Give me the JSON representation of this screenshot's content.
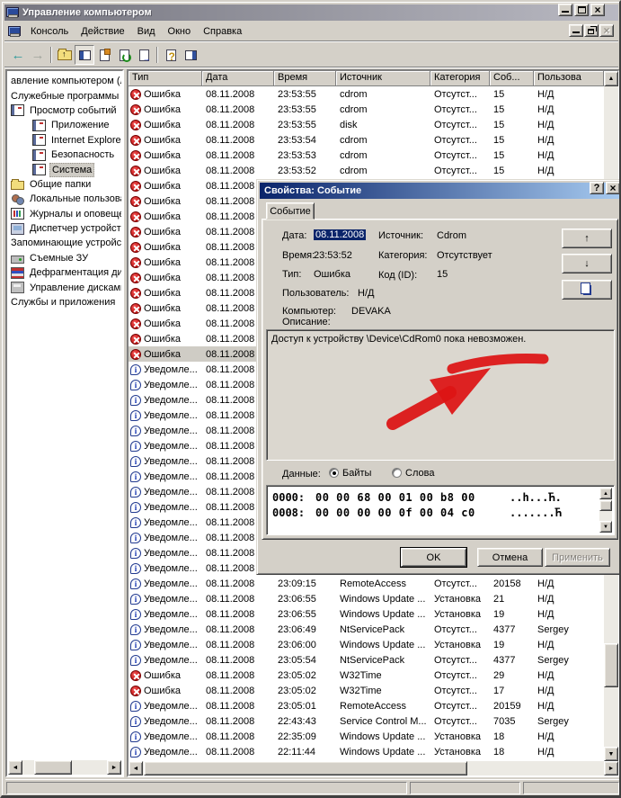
{
  "window": {
    "title": "Управление компьютером",
    "controls": {
      "minimize": "minimize",
      "maximize": "maximize",
      "close": "close"
    }
  },
  "menu": {
    "items": [
      "Консоль",
      "Действие",
      "Вид",
      "Окно",
      "Справка"
    ]
  },
  "toolbar": {
    "buttons": [
      {
        "icon": "back-icon",
        "glyph": "←"
      },
      {
        "icon": "forward-icon",
        "glyph": "→"
      },
      {
        "icon": "separator"
      },
      {
        "icon": "up-folder-icon"
      },
      {
        "icon": "toggle-tree-icon",
        "pressed": true
      },
      {
        "icon": "properties-icon"
      },
      {
        "icon": "refresh-icon"
      },
      {
        "icon": "export-list-icon"
      },
      {
        "icon": "separator"
      },
      {
        "icon": "help-icon"
      },
      {
        "icon": "show-panel-icon"
      }
    ]
  },
  "sidebar": {
    "items": [
      {
        "label": "авление компьютером (л",
        "level": 0,
        "icon": ""
      },
      {
        "label": "Служебные программы",
        "level": 0,
        "icon": ""
      },
      {
        "label": "Просмотр событий",
        "level": 1,
        "icon": "event-log"
      },
      {
        "label": "Приложение",
        "level": 2,
        "icon": "log-book"
      },
      {
        "label": "Internet Explorer",
        "level": 2,
        "icon": "log-book"
      },
      {
        "label": "Безопасность",
        "level": 2,
        "icon": "log-book"
      },
      {
        "label": "Система",
        "level": 2,
        "icon": "log-book",
        "selected": true
      },
      {
        "label": "Общие папки",
        "level": 1,
        "icon": "folder"
      },
      {
        "label": "Локальные пользова",
        "level": 1,
        "icon": "users"
      },
      {
        "label": "Журналы и оповещен",
        "level": 1,
        "icon": "perf"
      },
      {
        "label": "Диспетчер устройсте",
        "level": 1,
        "icon": "devmgr"
      },
      {
        "label": "Запоминающие устройст",
        "level": 0,
        "icon": ""
      },
      {
        "label": "Съемные ЗУ",
        "level": 1,
        "icon": "removable"
      },
      {
        "label": "Дефрагментация дис",
        "level": 1,
        "icon": "defrag"
      },
      {
        "label": "Управление дисками",
        "level": 1,
        "icon": "diskmgmt"
      },
      {
        "label": "Службы и приложения",
        "level": 0,
        "icon": ""
      }
    ]
  },
  "table": {
    "columns": [
      "Тип",
      "Дата",
      "Время",
      "Источник",
      "Категория",
      "Соб...",
      "Пользова"
    ],
    "type_labels": {
      "error": "Ошибка",
      "info": "Уведомле..."
    },
    "rows": [
      {
        "type": "error",
        "date": "08.11.2008",
        "time": "23:53:55",
        "source": "cdrom",
        "category": "Отсутст...",
        "event": "15",
        "user": "Н/Д"
      },
      {
        "type": "error",
        "date": "08.11.2008",
        "time": "23:53:55",
        "source": "cdrom",
        "category": "Отсутст...",
        "event": "15",
        "user": "Н/Д"
      },
      {
        "type": "error",
        "date": "08.11.2008",
        "time": "23:53:55",
        "source": "disk",
        "category": "Отсутст...",
        "event": "15",
        "user": "Н/Д"
      },
      {
        "type": "error",
        "date": "08.11.2008",
        "time": "23:53:54",
        "source": "cdrom",
        "category": "Отсутст...",
        "event": "15",
        "user": "Н/Д"
      },
      {
        "type": "error",
        "date": "08.11.2008",
        "time": "23:53:53",
        "source": "cdrom",
        "category": "Отсутст...",
        "event": "15",
        "user": "Н/Д"
      },
      {
        "type": "error",
        "date": "08.11.2008",
        "time": "23:53:52",
        "source": "cdrom",
        "category": "Отсутст...",
        "event": "15",
        "user": "Н/Д"
      },
      {
        "type": "error",
        "date": "08.11.2008",
        "time": "",
        "source": "",
        "category": "",
        "event": "",
        "user": ""
      },
      {
        "type": "error",
        "date": "08.11.2008",
        "time": "",
        "source": "",
        "category": "",
        "event": "",
        "user": ""
      },
      {
        "type": "error",
        "date": "08.11.2008",
        "time": "",
        "source": "",
        "category": "",
        "event": "",
        "user": ""
      },
      {
        "type": "error",
        "date": "08.11.2008",
        "time": "",
        "source": "",
        "category": "",
        "event": "",
        "user": ""
      },
      {
        "type": "error",
        "date": "08.11.2008",
        "time": "",
        "source": "",
        "category": "",
        "event": "",
        "user": ""
      },
      {
        "type": "error",
        "date": "08.11.2008",
        "time": "",
        "source": "",
        "category": "",
        "event": "",
        "user": ""
      },
      {
        "type": "error",
        "date": "08.11.2008",
        "time": "",
        "source": "",
        "category": "",
        "event": "",
        "user": ""
      },
      {
        "type": "error",
        "date": "08.11.2008",
        "time": "",
        "source": "",
        "category": "",
        "event": "",
        "user": ""
      },
      {
        "type": "error",
        "date": "08.11.2008",
        "time": "",
        "source": "",
        "category": "",
        "event": "",
        "user": ""
      },
      {
        "type": "error",
        "date": "08.11.2008",
        "time": "",
        "source": "",
        "category": "",
        "event": "",
        "user": ""
      },
      {
        "type": "error",
        "date": "08.11.2008",
        "time": "",
        "source": "",
        "category": "",
        "event": "",
        "user": ""
      },
      {
        "type": "error",
        "date": "08.11.2008",
        "time": "",
        "source": "",
        "category": "",
        "event": "",
        "user": "",
        "selected": true
      },
      {
        "type": "info",
        "date": "08.11.2008",
        "time": "",
        "source": "",
        "category": "",
        "event": "",
        "user": ""
      },
      {
        "type": "info",
        "date": "08.11.2008",
        "time": "",
        "source": "",
        "category": "",
        "event": "",
        "user": ""
      },
      {
        "type": "info",
        "date": "08.11.2008",
        "time": "",
        "source": "",
        "category": "",
        "event": "",
        "user": ""
      },
      {
        "type": "info",
        "date": "08.11.2008",
        "time": "",
        "source": "",
        "category": "",
        "event": "",
        "user": ""
      },
      {
        "type": "info",
        "date": "08.11.2008",
        "time": "",
        "source": "",
        "category": "",
        "event": "",
        "user": ""
      },
      {
        "type": "info",
        "date": "08.11.2008",
        "time": "",
        "source": "",
        "category": "",
        "event": "",
        "user": ""
      },
      {
        "type": "info",
        "date": "08.11.2008",
        "time": "",
        "source": "",
        "category": "",
        "event": "",
        "user": ""
      },
      {
        "type": "info",
        "date": "08.11.2008",
        "time": "",
        "source": "",
        "category": "",
        "event": "",
        "user": ""
      },
      {
        "type": "info",
        "date": "08.11.2008",
        "time": "",
        "source": "",
        "category": "",
        "event": "",
        "user": ""
      },
      {
        "type": "info",
        "date": "08.11.2008",
        "time": "",
        "source": "",
        "category": "",
        "event": "",
        "user": ""
      },
      {
        "type": "info",
        "date": "08.11.2008",
        "time": "",
        "source": "",
        "category": "",
        "event": "",
        "user": ""
      },
      {
        "type": "info",
        "date": "08.11.2008",
        "time": "",
        "source": "",
        "category": "",
        "event": "",
        "user": ""
      },
      {
        "type": "info",
        "date": "08.11.2008",
        "time": "",
        "source": "",
        "category": "",
        "event": "",
        "user": ""
      },
      {
        "type": "info",
        "date": "08.11.2008",
        "time": "",
        "source": "",
        "category": "",
        "event": "",
        "user": ""
      },
      {
        "type": "info",
        "date": "08.11.2008",
        "time": "23:09:15",
        "source": "RemoteAccess",
        "category": "Отсутст...",
        "event": "20158",
        "user": "Н/Д"
      },
      {
        "type": "info",
        "date": "08.11.2008",
        "time": "23:06:55",
        "source": "Windows Update ...",
        "category": "Установка",
        "event": "21",
        "user": "Н/Д"
      },
      {
        "type": "info",
        "date": "08.11.2008",
        "time": "23:06:55",
        "source": "Windows Update ...",
        "category": "Установка",
        "event": "19",
        "user": "Н/Д"
      },
      {
        "type": "info",
        "date": "08.11.2008",
        "time": "23:06:49",
        "source": "NtServicePack",
        "category": "Отсутст...",
        "event": "4377",
        "user": "Sergey"
      },
      {
        "type": "info",
        "date": "08.11.2008",
        "time": "23:06:00",
        "source": "Windows Update ...",
        "category": "Установка",
        "event": "19",
        "user": "Н/Д"
      },
      {
        "type": "info",
        "date": "08.11.2008",
        "time": "23:05:54",
        "source": "NtServicePack",
        "category": "Отсутст...",
        "event": "4377",
        "user": "Sergey"
      },
      {
        "type": "error",
        "date": "08.11.2008",
        "time": "23:05:02",
        "source": "W32Time",
        "category": "Отсутст...",
        "event": "29",
        "user": "Н/Д"
      },
      {
        "type": "error",
        "date": "08.11.2008",
        "time": "23:05:02",
        "source": "W32Time",
        "category": "Отсутст...",
        "event": "17",
        "user": "Н/Д"
      },
      {
        "type": "info",
        "date": "08.11.2008",
        "time": "23:05:01",
        "source": "RemoteAccess",
        "category": "Отсутст...",
        "event": "20159",
        "user": "Н/Д"
      },
      {
        "type": "info",
        "date": "08.11.2008",
        "time": "22:43:43",
        "source": "Service Control M...",
        "category": "Отсутст...",
        "event": "7035",
        "user": "Sergey"
      },
      {
        "type": "info",
        "date": "08.11.2008",
        "time": "22:35:09",
        "source": "Windows Update ...",
        "category": "Установка",
        "event": "18",
        "user": "Н/Д"
      },
      {
        "type": "info",
        "date": "08.11.2008",
        "time": "22:11:44",
        "source": "Windows Update ...",
        "category": "Установка",
        "event": "18",
        "user": "Н/Д"
      }
    ]
  },
  "dialog": {
    "title": "Свойства: Событие",
    "tab_label": "Событие",
    "fields": {
      "date_label": "Дата:",
      "date_value": "08.11.2008",
      "time_label": "Время:",
      "time_value": "23:53:52",
      "type_label": "Тип:",
      "type_value": "Ошибка",
      "source_label": "Источник:",
      "source_value": "Cdrom",
      "category_label": "Категория:",
      "category_value": "Отсутствует",
      "code_label": "Код (ID):",
      "code_value": "15",
      "user_label": "Пользователь:",
      "user_value": "Н/Д",
      "computer_label": "Компьютер:",
      "computer_value": "DEVAKA"
    },
    "up_glyph": "↑",
    "down_glyph": "↓",
    "description_label": "Описание:",
    "description_text": "Доступ к устройству \\Device\\CdRom0 пока невозможен.",
    "data_label": "Данные:",
    "radio_bytes_label": "Байты",
    "radio_words_label": "Слова",
    "radio_selected": "Байты",
    "hex_rows": [
      {
        "offset": "0000:",
        "bytes": "00 00 68 00 01 00 b8 00",
        "ascii": "..h...Ћ."
      },
      {
        "offset": "0008:",
        "bytes": "00 00 00 00 0f 00 04 c0",
        "ascii": ".......Ћ"
      }
    ],
    "ok_label": "OK",
    "cancel_label": "Отмена",
    "apply_label": "Применить"
  },
  "colors": {
    "window_bg": "#d4d0c8",
    "dialog_titlebar_start": "#0a246a",
    "dialog_titlebar_end": "#a6caf0",
    "selection_blue": "#0a246a",
    "error_red": "#b00000",
    "info_blue": "#1030b0",
    "annotation_red": "#dd1414"
  }
}
